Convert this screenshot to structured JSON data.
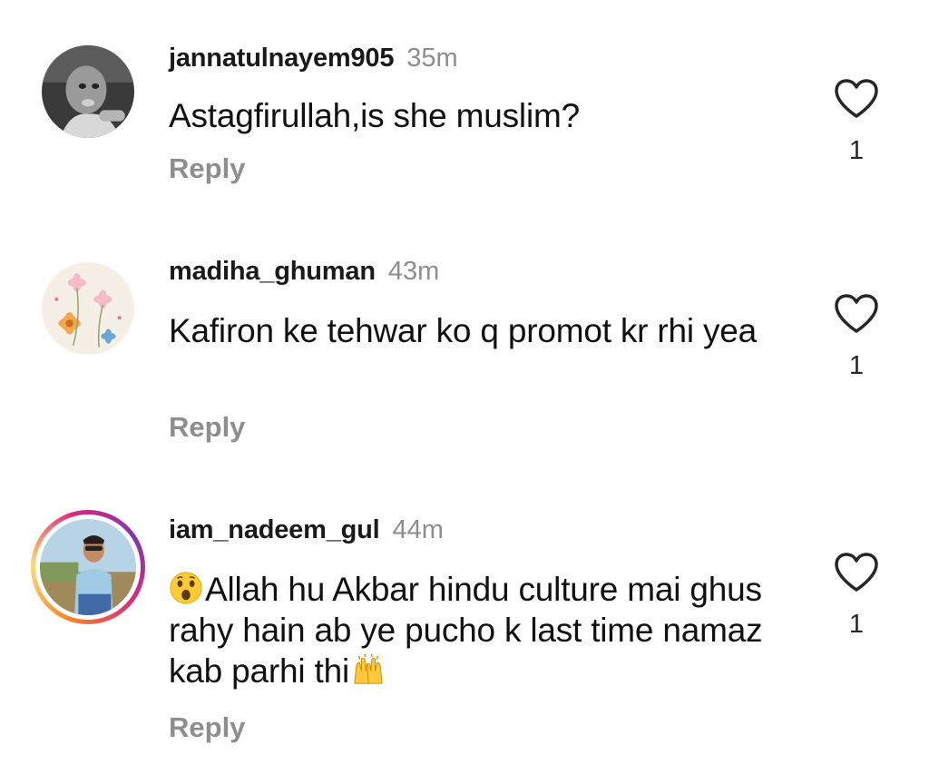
{
  "comments": [
    {
      "username": "jannatulnayem905",
      "time": "35m",
      "text": "Astagfirullah,is she muslim?",
      "reply_label": "Reply",
      "likes": "1",
      "avatar_icon": "child-photo-avatar"
    },
    {
      "username": "madiha_ghuman",
      "time": "43m",
      "text": "Kafiron ke tehwar ko q promot kr rhi yea",
      "reply_label": "Reply",
      "likes": "1",
      "avatar_icon": "flowers-avatar"
    },
    {
      "username": "iam_nadeem_gul",
      "time": "44m",
      "text_prefix_emoji": "surprised-face-emoji",
      "text": "Allah hu Akbar hindu culture mai ghus rahy hain ab ye pucho k last time namaz kab parhi thi",
      "text_suffix_emoji": "raising-hands-emoji",
      "reply_label": "Reply",
      "likes": "1",
      "avatar_icon": "man-photo-avatar",
      "has_story_ring": true
    }
  ],
  "colors": {
    "username": "#1a1a1a",
    "secondary": "#8e8e8e",
    "text": "#111111"
  }
}
